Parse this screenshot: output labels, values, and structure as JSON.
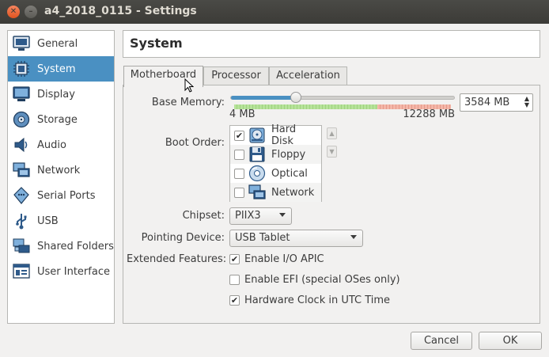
{
  "window": {
    "title": "a4_2018_0115 - Settings"
  },
  "sidebar": {
    "items": [
      {
        "label": "General",
        "icon": "general-icon",
        "active": false
      },
      {
        "label": "System",
        "icon": "system-icon",
        "active": true
      },
      {
        "label": "Display",
        "icon": "display-icon",
        "active": false
      },
      {
        "label": "Storage",
        "icon": "storage-icon",
        "active": false
      },
      {
        "label": "Audio",
        "icon": "audio-icon",
        "active": false
      },
      {
        "label": "Network",
        "icon": "network-icon",
        "active": false
      },
      {
        "label": "Serial Ports",
        "icon": "serial-ports-icon",
        "active": false
      },
      {
        "label": "USB",
        "icon": "usb-icon",
        "active": false
      },
      {
        "label": "Shared Folders",
        "icon": "shared-folders-icon",
        "active": false
      },
      {
        "label": "User Interface",
        "icon": "user-interface-icon",
        "active": false
      }
    ]
  },
  "section": {
    "title": "System"
  },
  "tabs": [
    {
      "label": "Motherboard",
      "active": true
    },
    {
      "label": "Processor",
      "active": false
    },
    {
      "label": "Acceleration",
      "active": false
    }
  ],
  "motherboard": {
    "base_memory": {
      "label": "Base Memory:",
      "value": "3584 MB",
      "value_mb": 3584,
      "min_label": "4 MB",
      "max_label": "12288 MB",
      "min_mb": 4,
      "max_mb": 12288,
      "recommended_fraction": 0.66
    },
    "boot_order": {
      "label": "Boot Order:",
      "items": [
        {
          "label": "Hard Disk",
          "checked": true,
          "icon": "hard-disk-icon"
        },
        {
          "label": "Floppy",
          "checked": false,
          "icon": "floppy-icon"
        },
        {
          "label": "Optical",
          "checked": false,
          "icon": "optical-disc-icon"
        },
        {
          "label": "Network",
          "checked": false,
          "icon": "network-icon"
        }
      ]
    },
    "chipset": {
      "label": "Chipset:",
      "value": "PIIX3"
    },
    "pointing_device": {
      "label": "Pointing Device:",
      "value": "USB Tablet"
    },
    "extended_features": {
      "label": "Extended Features:",
      "options": [
        {
          "label": "Enable I/O APIC",
          "checked": true
        },
        {
          "label": "Enable EFI (special OSes only)",
          "checked": false
        },
        {
          "label": "Hardware Clock in UTC Time",
          "checked": true
        }
      ]
    }
  },
  "buttons": {
    "cancel": "Cancel",
    "ok": "OK"
  },
  "colors": {
    "accent": "#4a90c2",
    "titlebar": "#3c3b37",
    "close": "#e0531f"
  }
}
